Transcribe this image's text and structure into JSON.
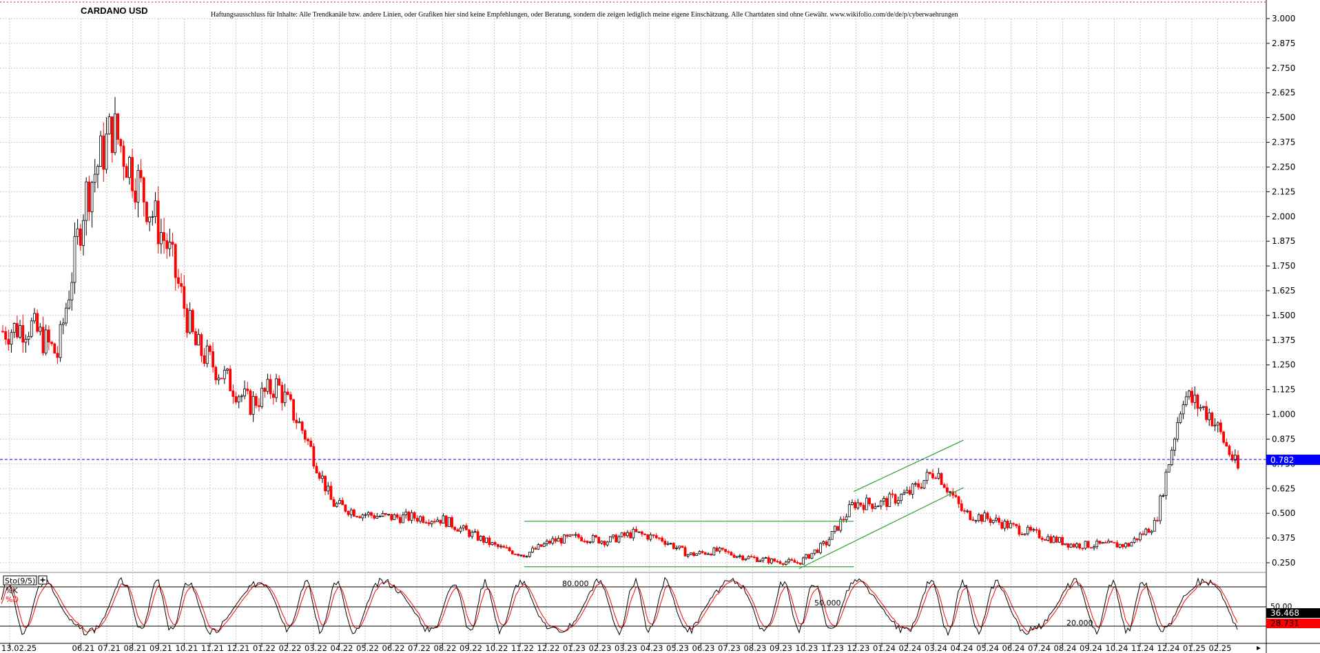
{
  "header": {
    "title": "CARDANO USD",
    "disclaimer": "Haftungsausschluss für Inhalte: Alle Trendkanäle bzw. andere Linien, oder Grafiken hier sind keine Empfehlungen, oder Beratung, sondern die zeigen lediglich meine eigene Einschätzung. Alle Chartdaten sind ohne Gewähr.  www.wikifolio.com/de/de/p/cyberwaehrungen"
  },
  "colors": {
    "up": "#000000",
    "down": "#ff0000",
    "trend": "#2ca02c",
    "last_price_bg": "#0000ff",
    "k_line": "#000000",
    "d_line": "#ff0000",
    "grid": "#c8c8c8"
  },
  "price_panel": {
    "last_price_label": "0.782",
    "last_price": 0.782,
    "ylim": [
      0.22,
      3.06
    ],
    "yticks": [
      "3.000",
      "2.875",
      "2.750",
      "2.625",
      "2.500",
      "2.375",
      "2.250",
      "2.125",
      "2.000",
      "1.875",
      "1.750",
      "1.625",
      "1.500",
      "1.375",
      "1.250",
      "1.125",
      "1.000",
      "0.875",
      "0.750",
      "0.625",
      "0.500",
      "0.375",
      "0.250"
    ]
  },
  "stoch_panel": {
    "indicator_label": "Sto(9/5)",
    "k_label": "%K",
    "d_label": "%D",
    "k_value": "36.468",
    "d_value": "28.731",
    "level_80": "80.000",
    "level_50": "50.000",
    "level_20": "20.000",
    "axis_50": "50.00"
  },
  "x_axis": {
    "labels": [
      "13.02.25",
      "06.21",
      "07.21",
      "08.21",
      "09.21",
      "10.21",
      "11.21",
      "12.21",
      "01.22",
      "02.22",
      "03.22",
      "04.22",
      "05.22",
      "06.22",
      "07.22",
      "08.22",
      "09.22",
      "10.22",
      "11.22",
      "12.22",
      "01.23",
      "02.23",
      "03.23",
      "04.23",
      "05.23",
      "06.23",
      "07.23",
      "08.23",
      "09.23",
      "10.23",
      "11.23",
      "12.23",
      "01.24",
      "02.24",
      "03.24",
      "04.24",
      "05.24",
      "06.24",
      "07.24",
      "08.24",
      "09.24",
      "10.24",
      "11.24",
      "12.24",
      "01.25",
      "02.25"
    ]
  },
  "chart_data": {
    "type": "candlestick",
    "title": "CARDANO USD",
    "x_unit": "month",
    "x_start": "2021-05",
    "x": [
      "2021-05",
      "2021-06",
      "2021-07",
      "2021-08",
      "2021-09",
      "2021-10",
      "2021-11",
      "2021-12",
      "2022-01",
      "2022-02",
      "2022-03",
      "2022-04",
      "2022-05",
      "2022-06",
      "2022-07",
      "2022-08",
      "2022-09",
      "2022-10",
      "2022-11",
      "2022-12",
      "2023-01",
      "2023-02",
      "2023-03",
      "2023-04",
      "2023-05",
      "2023-06",
      "2023-07",
      "2023-08",
      "2023-09",
      "2023-10",
      "2023-11",
      "2023-12",
      "2024-01",
      "2024-02",
      "2024-03",
      "2024-04",
      "2024-05",
      "2024-06",
      "2024-07",
      "2024-08",
      "2024-09",
      "2024-10",
      "2024-11",
      "2024-12",
      "2025-01",
      "2025-02"
    ],
    "series": [
      {
        "name": "close",
        "values": [
          1.42,
          1.45,
          1.3,
          2.1,
          2.45,
          2.15,
          1.85,
          1.35,
          1.2,
          1.05,
          1.15,
          0.9,
          0.55,
          0.5,
          0.48,
          0.48,
          0.47,
          0.4,
          0.33,
          0.29,
          0.36,
          0.38,
          0.36,
          0.4,
          0.37,
          0.29,
          0.31,
          0.28,
          0.26,
          0.25,
          0.35,
          0.55,
          0.55,
          0.6,
          0.72,
          0.5,
          0.47,
          0.42,
          0.38,
          0.34,
          0.34,
          0.34,
          0.45,
          1.1,
          1.0,
          0.72
        ]
      },
      {
        "name": "%K",
        "values": []
      },
      {
        "name": "%D",
        "values": []
      }
    ],
    "trend_lines": [
      {
        "from": [
          "2022-12",
          0.46
        ],
        "to": [
          "2023-12",
          0.46
        ]
      },
      {
        "from": [
          "2022-12",
          0.23
        ],
        "to": [
          "2023-12",
          0.23
        ]
      },
      {
        "from": [
          "2023-12",
          0.61
        ],
        "to": [
          "2024-04",
          0.87
        ]
      },
      {
        "from": [
          "2023-10",
          0.22
        ],
        "to": [
          "2024-04",
          0.63
        ]
      }
    ],
    "ylim": [
      0.22,
      3.06
    ],
    "stochastic_levels": [
      80,
      50,
      20
    ],
    "grid": true
  }
}
